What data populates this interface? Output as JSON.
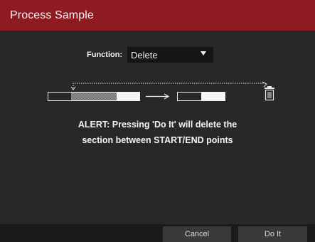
{
  "dialog": {
    "title": "Process Sample"
  },
  "function": {
    "label": "Function:",
    "value": "Delete"
  },
  "alert": {
    "line1": "ALERT: Pressing 'Do It' will delete the",
    "line2": "section between START/END points"
  },
  "footer": {
    "cancel_label": "Cancel",
    "doit_label": "Do It"
  },
  "colors": {
    "titlebar": "#8e1a22",
    "background": "#282828",
    "footer": "#1a1a1a"
  },
  "icons": [
    "dropdown-caret-icon",
    "arrow-right-icon",
    "trash-icon"
  ]
}
